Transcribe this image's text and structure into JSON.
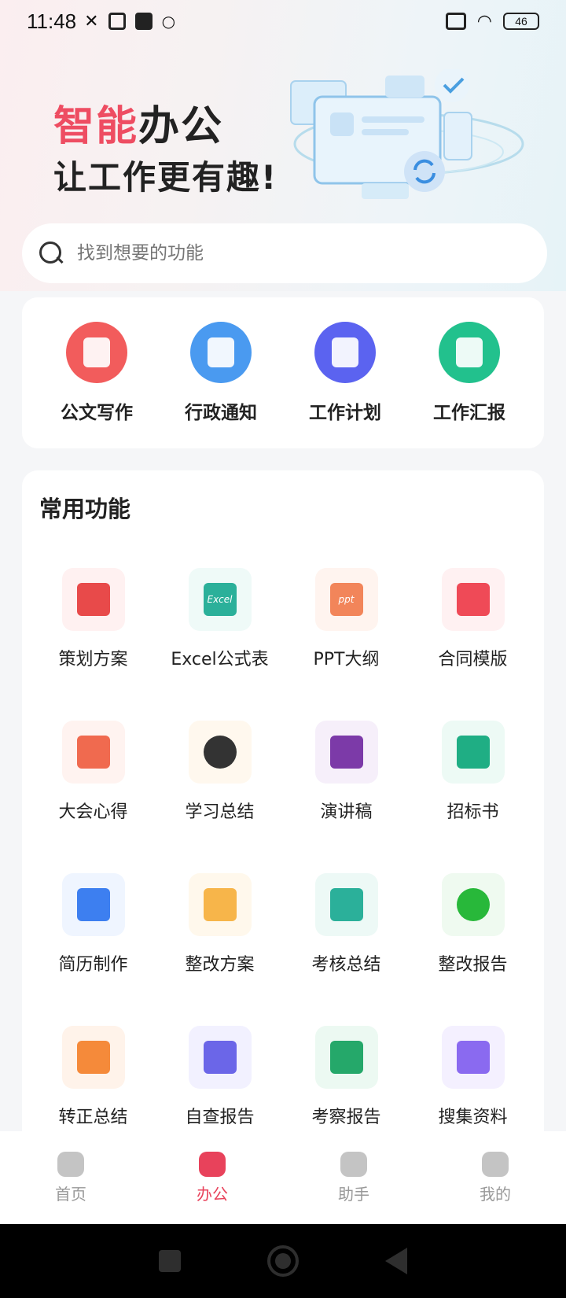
{
  "status_bar": {
    "time": "11:48",
    "battery": "46"
  },
  "hero": {
    "title_accent": "智能",
    "title_rest": "办公",
    "subtitle": "让工作更有趣!"
  },
  "search": {
    "placeholder": "找到想要的功能"
  },
  "quick_actions": [
    {
      "label": "公文写作",
      "icon": "pencil-doc-icon",
      "color": "#f25c5c"
    },
    {
      "label": "行政通知",
      "icon": "laptop-icon",
      "color": "#4a9af0"
    },
    {
      "label": "工作计划",
      "icon": "calendar-doc-icon",
      "color": "#5b63f0"
    },
    {
      "label": "工作汇报",
      "icon": "clipboard-icon",
      "color": "#22c18d"
    }
  ],
  "common": {
    "title": "常用功能",
    "items": [
      {
        "label": "策划方案",
        "icon": "bookmark-doc-icon",
        "color": "#e84a4a",
        "bg": "#fff1f1"
      },
      {
        "label": "Excel公式表",
        "icon": "excel-icon",
        "color": "#2bb09a",
        "bg": "#effaf8",
        "glyph": "Excel"
      },
      {
        "label": "PPT大纲",
        "icon": "ppt-icon",
        "color": "#f2855a",
        "bg": "#fff4ef",
        "glyph": "ppt"
      },
      {
        "label": "合同模版",
        "icon": "contract-icon",
        "color": "#ef4a57",
        "bg": "#fff1f2"
      },
      {
        "label": "大会心得",
        "icon": "notebook-heart-icon",
        "color": "#f06a4f",
        "bg": "#fff3f0"
      },
      {
        "label": "学习总结",
        "icon": "open-book-icon",
        "color": "#333333",
        "bg": "#fff8ee"
      },
      {
        "label": "演讲稿",
        "icon": "speech-doc-icon",
        "color": "#7c3aa8",
        "bg": "#f6effa"
      },
      {
        "label": "招标书",
        "icon": "gavel-icon",
        "color": "#1fae84",
        "bg": "#edfaf5"
      },
      {
        "label": "简历制作",
        "icon": "resume-icon",
        "color": "#3d7ff0",
        "bg": "#eff5ff"
      },
      {
        "label": "整改方案",
        "icon": "person-doc-icon",
        "color": "#f7b54a",
        "bg": "#fff8ec"
      },
      {
        "label": "考核总结",
        "icon": "check-doc-icon",
        "color": "#2bb09a",
        "bg": "#edf9f6"
      },
      {
        "label": "整改报告",
        "icon": "edit-circle-icon",
        "color": "#28b83a",
        "bg": "#effaf0"
      },
      {
        "label": "转正总结",
        "icon": "user-check-icon",
        "color": "#f58a3a",
        "bg": "#fff3ea"
      },
      {
        "label": "自查报告",
        "icon": "search-doc-icon",
        "color": "#6b66e8",
        "bg": "#f2f1ff"
      },
      {
        "label": "考察报告",
        "icon": "magnifier-icon",
        "color": "#25a86a",
        "bg": "#ecf9f2"
      },
      {
        "label": "搜集资料",
        "icon": "collect-doc-icon",
        "color": "#8a6af0",
        "bg": "#f4f0ff"
      }
    ]
  },
  "bottom_nav": [
    {
      "label": "首页",
      "icon": "home-icon",
      "active": false
    },
    {
      "label": "办公",
      "icon": "office-icon",
      "active": true
    },
    {
      "label": "助手",
      "icon": "assistant-icon",
      "active": false
    },
    {
      "label": "我的",
      "icon": "profile-icon",
      "active": false
    }
  ],
  "colors": {
    "accent": "#ee4d62",
    "nav_active": "#e8425b"
  }
}
